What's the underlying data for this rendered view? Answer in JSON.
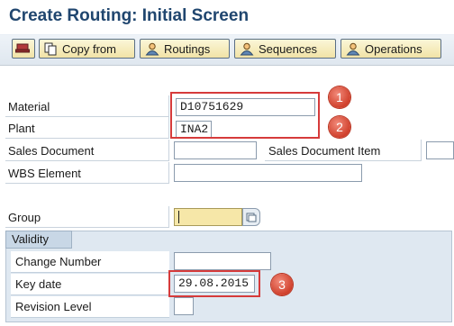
{
  "screen": {
    "title": "Create Routing: Initial Screen"
  },
  "toolbar": {
    "copy_from": "Copy from",
    "routings": "Routings",
    "sequences": "Sequences",
    "operations": "Operations"
  },
  "form": {
    "material": {
      "label": "Material",
      "value": "D10751629"
    },
    "plant": {
      "label": "Plant",
      "value": "INA2"
    },
    "sales_document": {
      "label": "Sales Document",
      "value": ""
    },
    "sales_document_item": {
      "label": "Sales Document Item",
      "value": ""
    },
    "wbs_element": {
      "label": "WBS Element",
      "value": ""
    },
    "group": {
      "label": "Group",
      "value": ""
    }
  },
  "validity": {
    "tab_label": "Validity",
    "change_number": {
      "label": "Change Number",
      "value": ""
    },
    "key_date": {
      "label": "Key date",
      "value": "29.08.2015"
    },
    "revision_level": {
      "label": "Revision Level",
      "value": ""
    }
  },
  "annotations": [
    "1",
    "2",
    "3"
  ],
  "colors": {
    "title": "#20466f",
    "highlight": "#d63b3b",
    "marker": "#d0402c",
    "button_fill": "#f1e3a6",
    "required_field": "#f6e7a8"
  }
}
